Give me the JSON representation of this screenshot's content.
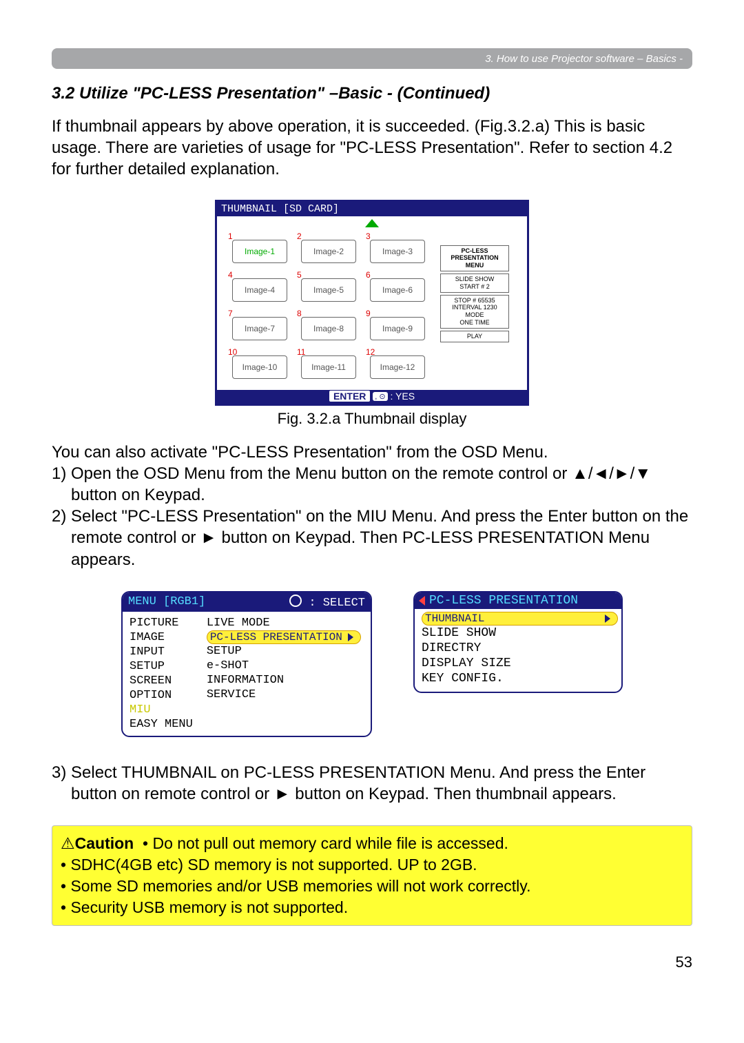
{
  "header": {
    "bar_text": "3. How to use Projector software – Basics -"
  },
  "section_title": "3.2 Utilize \"PC-LESS Presentation\" –Basic - (Continued)",
  "para1": "If thumbnail appears by above operation, it is succeeded. (Fig.3.2.a) This is basic usage. There are varieties of usage for \"PC-LESS Presentation\". Refer to section 4.2 for further detailed explanation.",
  "fig_caption": "Fig. 3.2.a Thumbnail display",
  "thumb": {
    "title": "THUMBNAIL [SD CARD]",
    "cells": [
      [
        "1",
        "Image-1",
        true
      ],
      [
        "2",
        "Image-2",
        false
      ],
      [
        "3",
        "Image-3",
        false
      ],
      [
        "4",
        "Image-4",
        false
      ],
      [
        "5",
        "Image-5",
        false
      ],
      [
        "6",
        "Image-6",
        false
      ],
      [
        "7",
        "Image-7",
        false
      ],
      [
        "8",
        "Image-8",
        false
      ],
      [
        "9",
        "Image-9",
        false
      ],
      [
        "10",
        "Image-10",
        false
      ],
      [
        "11",
        "Image-11",
        false
      ],
      [
        "12",
        "Image-12",
        false
      ]
    ],
    "side1": "PC-LESS\nPRESENTATION\nMENU",
    "side2": "SLIDE SHOW\nSTART # 2",
    "side3": "STOP #   65535\nINTERVAL 1230\nMODE\n      ONE TIME",
    "side4": "PLAY",
    "footer_enter": "ENTER",
    "footer_yes": ": YES"
  },
  "osd_intro": "You can also activate \"PC-LESS Presentation\" from the OSD Menu.",
  "step1": "1) Open the OSD Menu from the Menu button on the remote control or ▲/◄/►/▼ button on Keypad.",
  "step2": "2) Select \"PC-LESS Presentation\" on the MIU Menu. And press the Enter button on the remote control or ► button on Keypad. Then PC-LESS PRESENTATION Menu appears.",
  "menu_main": {
    "head_left": "MENU [RGB1]",
    "head_right": ": SELECT",
    "left_items": [
      "PICTURE",
      "IMAGE",
      "INPUT",
      "SETUP",
      "SCREEN",
      "OPTION",
      "MIU",
      "EASY MENU"
    ],
    "right_items": [
      "LIVE MODE",
      "PC-LESS PRESENTATION",
      "SETUP",
      "e-SHOT",
      "INFORMATION",
      "SERVICE"
    ]
  },
  "menu_pc": {
    "head": "PC-LESS PRESENTATION",
    "items": [
      "THUMBNAIL",
      "SLIDE SHOW",
      "DIRECTRY",
      "DISPLAY SIZE",
      "KEY CONFIG."
    ]
  },
  "step3": "3) Select THUMBNAIL on PC-LESS PRESENTATION Menu. And press the Enter button on remote control or ► button on Keypad. Then thumbnail appears.",
  "caution": {
    "label": "Caution",
    "line1": "• Do not pull out memory card while file is accessed.",
    "line2": "• SDHC(4GB etc) SD memory is not supported. UP to 2GB.",
    "line3": "• Some SD memories and/or USB memories will not work correctly.",
    "line4": "• Security USB memory is not supported."
  },
  "page_number": "53"
}
